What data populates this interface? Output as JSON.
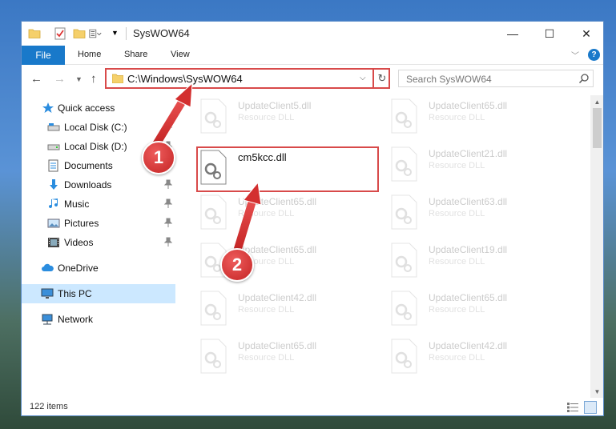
{
  "window": {
    "title": "SysWOW64",
    "controls": {
      "minimize": "—",
      "maximize": "☐",
      "close": "✕"
    }
  },
  "ribbon": {
    "tabs": [
      {
        "label": "File"
      },
      {
        "label": "Home"
      },
      {
        "label": "Share"
      },
      {
        "label": "View"
      }
    ],
    "help_label": "?"
  },
  "navbar": {
    "address": "C:\\Windows\\SysWOW64",
    "search_placeholder": "Search SysWOW64"
  },
  "sidebar": {
    "items": [
      {
        "label": "Quick access",
        "icon": "star-icon"
      },
      {
        "label": "Local Disk (C:)",
        "icon": "drive-icon"
      },
      {
        "label": "Local Disk (D:)",
        "icon": "drive-icon"
      },
      {
        "label": "Documents",
        "icon": "documents-icon"
      },
      {
        "label": "Downloads",
        "icon": "downloads-icon"
      },
      {
        "label": "Music",
        "icon": "music-icon"
      },
      {
        "label": "Pictures",
        "icon": "pictures-icon"
      },
      {
        "label": "Videos",
        "icon": "videos-icon"
      },
      {
        "label": "OneDrive",
        "icon": "cloud-icon"
      },
      {
        "label": "This PC",
        "icon": "computer-icon",
        "selected": true
      },
      {
        "label": "Network",
        "icon": "network-icon"
      }
    ]
  },
  "files": [
    {
      "name": "UpdateClient5.dll",
      "type": "Resource DLL"
    },
    {
      "name": "UpdateClient65.dll",
      "type": "Resource DLL"
    },
    {
      "name": "cm5kcc.dll",
      "type": ""
    },
    {
      "name": "UpdateClient21.dll",
      "type": "Resource DLL"
    },
    {
      "name": "UpdateClient65.dll",
      "type": "Resource DLL"
    },
    {
      "name": "UpdateClient63.dll",
      "type": "Resource DLL"
    },
    {
      "name": "UpdateClient65.dll",
      "type": "Resource DLL"
    },
    {
      "name": "UpdateClient19.dll",
      "type": "Resource DLL"
    },
    {
      "name": "UpdateClient42.dll",
      "type": "Resource DLL"
    },
    {
      "name": "UpdateClient65.dll",
      "type": "Resource DLL"
    },
    {
      "name": "UpdateClient65.dll",
      "type": "Resource DLL"
    },
    {
      "name": "UpdateClient42.dll",
      "type": "Resource DLL"
    }
  ],
  "status": {
    "item_count": "122 items"
  },
  "annotations": {
    "step1": "1",
    "step2": "2"
  },
  "colors": {
    "accent": "#1979ca",
    "highlight": "#d84a4a",
    "selected": "#cce8ff"
  }
}
